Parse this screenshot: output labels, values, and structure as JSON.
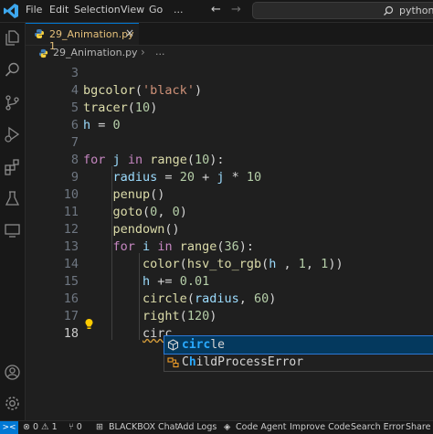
{
  "menu": {
    "file": "File",
    "edit": "Edit",
    "selection": "Selection",
    "view": "View",
    "go": "Go",
    "more": "..."
  },
  "nav": {
    "back": "←",
    "forward": "→"
  },
  "command_center": {
    "text": "python",
    "icon": "search-icon"
  },
  "activity_icons": [
    "explorer-icon",
    "search-icon",
    "source-control-icon",
    "run-debug-icon",
    "extensions-icon",
    "testing-icon",
    "remote-explorer-icon",
    "accounts-icon",
    "settings-gear-icon"
  ],
  "tab": {
    "label": "29_Animation.py 1",
    "close": "×"
  },
  "breadcrumb": {
    "file": "29_Animation.py",
    "separator": "›",
    "symbol": "..."
  },
  "editor": {
    "lines": [
      {
        "number": "3",
        "tokens": []
      },
      {
        "number": "4",
        "tokens": [
          {
            "text": "bgcolor",
            "type": "fn"
          },
          {
            "text": "(",
            "type": "plain"
          },
          {
            "text": "'black'",
            "type": "str"
          },
          {
            "text": ")",
            "type": "plain"
          }
        ]
      },
      {
        "number": "5",
        "tokens": [
          {
            "text": "tracer",
            "type": "fn"
          },
          {
            "text": "(",
            "type": "plain"
          },
          {
            "text": "10",
            "type": "num"
          },
          {
            "text": ")",
            "type": "plain"
          }
        ]
      },
      {
        "number": "6",
        "tokens": [
          {
            "text": "h",
            "type": "var"
          },
          {
            "text": " = ",
            "type": "plain"
          },
          {
            "text": "0",
            "type": "num"
          }
        ]
      },
      {
        "number": "7",
        "tokens": []
      },
      {
        "number": "8",
        "tokens": [
          {
            "text": "for",
            "type": "kw"
          },
          {
            "text": " ",
            "type": "plain"
          },
          {
            "text": "j",
            "type": "var"
          },
          {
            "text": " ",
            "type": "plain"
          },
          {
            "text": "in",
            "type": "kw"
          },
          {
            "text": " ",
            "type": "plain"
          },
          {
            "text": "range",
            "type": "fn"
          },
          {
            "text": "(",
            "type": "plain"
          },
          {
            "text": "10",
            "type": "num"
          },
          {
            "text": "):",
            "type": "plain"
          }
        ]
      },
      {
        "number": "9",
        "tokens": [
          {
            "text": "    ",
            "type": "plain"
          },
          {
            "text": "radius",
            "type": "var"
          },
          {
            "text": " = ",
            "type": "plain"
          },
          {
            "text": "20",
            "type": "num"
          },
          {
            "text": " + ",
            "type": "plain"
          },
          {
            "text": "j",
            "type": "var"
          },
          {
            "text": " * ",
            "type": "plain"
          },
          {
            "text": "10",
            "type": "num"
          }
        ]
      },
      {
        "number": "10",
        "tokens": [
          {
            "text": "    ",
            "type": "plain"
          },
          {
            "text": "penup",
            "type": "fn"
          },
          {
            "text": "()",
            "type": "plain"
          }
        ]
      },
      {
        "number": "11",
        "tokens": [
          {
            "text": "    ",
            "type": "plain"
          },
          {
            "text": "goto",
            "type": "fn"
          },
          {
            "text": "(",
            "type": "plain"
          },
          {
            "text": "0",
            "type": "num"
          },
          {
            "text": ", ",
            "type": "plain"
          },
          {
            "text": "0",
            "type": "num"
          },
          {
            "text": ")",
            "type": "plain"
          }
        ]
      },
      {
        "number": "12",
        "tokens": [
          {
            "text": "    ",
            "type": "plain"
          },
          {
            "text": "pendown",
            "type": "fn"
          },
          {
            "text": "()",
            "type": "plain"
          }
        ]
      },
      {
        "number": "13",
        "tokens": [
          {
            "text": "    ",
            "type": "plain"
          },
          {
            "text": "for",
            "type": "kw"
          },
          {
            "text": " ",
            "type": "plain"
          },
          {
            "text": "i",
            "type": "var"
          },
          {
            "text": " ",
            "type": "plain"
          },
          {
            "text": "in",
            "type": "kw"
          },
          {
            "text": " ",
            "type": "plain"
          },
          {
            "text": "range",
            "type": "fn"
          },
          {
            "text": "(",
            "type": "plain"
          },
          {
            "text": "36",
            "type": "num"
          },
          {
            "text": "):",
            "type": "plain"
          }
        ]
      },
      {
        "number": "14",
        "tokens": [
          {
            "text": "        ",
            "type": "plain"
          },
          {
            "text": "color",
            "type": "fn"
          },
          {
            "text": "(",
            "type": "plain"
          },
          {
            "text": "hsv_to_rgb",
            "type": "fn"
          },
          {
            "text": "(",
            "type": "plain"
          },
          {
            "text": "h",
            "type": "var"
          },
          {
            "text": " , ",
            "type": "plain"
          },
          {
            "text": "1",
            "type": "num"
          },
          {
            "text": ", ",
            "type": "plain"
          },
          {
            "text": "1",
            "type": "num"
          },
          {
            "text": "))",
            "type": "plain"
          }
        ]
      },
      {
        "number": "15",
        "tokens": [
          {
            "text": "        ",
            "type": "plain"
          },
          {
            "text": "h",
            "type": "var"
          },
          {
            "text": " += ",
            "type": "plain"
          },
          {
            "text": "0.01",
            "type": "num"
          }
        ]
      },
      {
        "number": "16",
        "tokens": [
          {
            "text": "        ",
            "type": "plain"
          },
          {
            "text": "circle",
            "type": "fn"
          },
          {
            "text": "(",
            "type": "plain"
          },
          {
            "text": "radius",
            "type": "var"
          },
          {
            "text": ", ",
            "type": "plain"
          },
          {
            "text": "60",
            "type": "num"
          },
          {
            "text": ")",
            "type": "plain"
          }
        ]
      },
      {
        "number": "17",
        "tokens": [
          {
            "text": "        ",
            "type": "plain"
          },
          {
            "text": "right",
            "type": "fn"
          },
          {
            "text": "(",
            "type": "plain"
          },
          {
            "text": "120",
            "type": "num"
          },
          {
            "text": ")",
            "type": "plain"
          }
        ]
      },
      {
        "number": "18",
        "tokens": [
          {
            "text": "        ",
            "type": "plain"
          },
          {
            "text": "circ",
            "type": "plain"
          }
        ],
        "active": true
      }
    ]
  },
  "suggestions": [
    {
      "match": "circ",
      "rest": "le",
      "icon": "method-icon"
    },
    {
      "prefix": "",
      "label": "ChildProcessError",
      "icon": "class-icon"
    }
  ],
  "suggestion_second": {
    "before": "C",
    "match1": "h",
    "mid": "ildProcessEr",
    "rest": "ror"
  },
  "status": {
    "remote": "><",
    "problems": "⊗ 0 ⚠ 1",
    "ports": "⑂ 0",
    "blackbox": "BLACKBOX Chat",
    "add_logs": "Add Logs",
    "code_agent": "Code Agent",
    "improve_code": "Improve Code",
    "search_error": "Search Error",
    "share": "Share C"
  },
  "colors": {
    "accent": "#0078d4",
    "keyword": "#c586c0",
    "function": "#dcdcaa",
    "string": "#ce9178",
    "number": "#b5cea8",
    "variable": "#9cdcfe"
  }
}
